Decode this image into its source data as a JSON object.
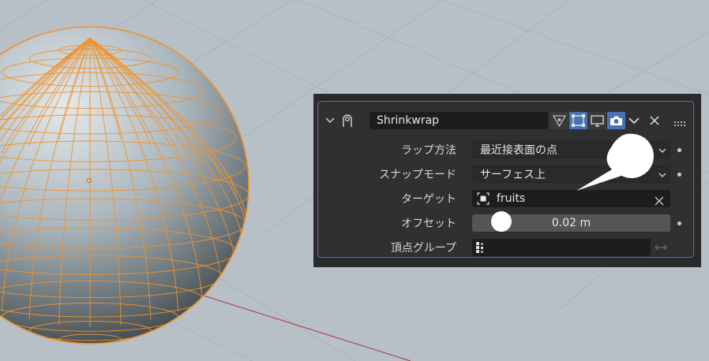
{
  "modifier": {
    "name": "Shrinkwrap",
    "header_icons": [
      "collapse-chevron-icon",
      "shrinkwrap-modifier-icon",
      "edit-mode-icon",
      "on-cage-icon",
      "realtime-display-icon",
      "render-icon",
      "options-dropdown-icon",
      "close-icon",
      "drag-handle-icon"
    ]
  },
  "properties": {
    "wrap_method": {
      "label": "ラップ方法",
      "value": "最近接表面の点"
    },
    "snap_mode": {
      "label": "スナップモード",
      "value": "サーフェス上"
    },
    "target": {
      "label": "ターゲット",
      "value": "fruits"
    },
    "offset": {
      "label": "オフセット",
      "value": "0.02 m"
    },
    "vertex_group": {
      "label": "頂点グループ",
      "value": ""
    }
  },
  "colors": {
    "selection_outline": "#f0922b",
    "active_toggle": "#4772b3",
    "panel_border": "#4a6fa5",
    "axis_x": "#b0484e"
  }
}
